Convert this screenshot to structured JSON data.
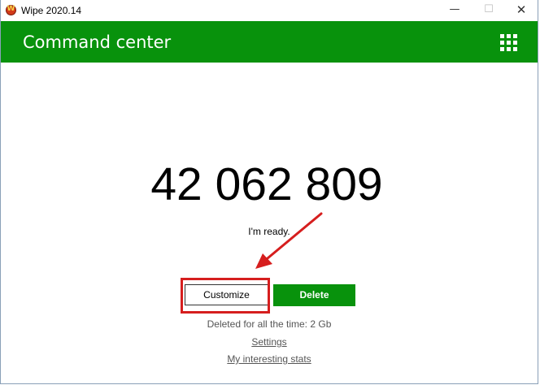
{
  "window": {
    "title": "Wipe 2020.14",
    "minimize_glyph": "—",
    "maximize_glyph": "☐",
    "close_glyph": "✕"
  },
  "header": {
    "title": "Command center",
    "menu_icon": "grid-icon"
  },
  "main": {
    "counter": "42 062 809",
    "status": "I'm ready.",
    "customize_label": "Customize",
    "delete_label": "Delete",
    "deleted_total": "Deleted for all the time: 2 Gb",
    "settings_link": "Settings",
    "stats_link": "My interesting stats"
  },
  "colors": {
    "brand_green": "#08920c",
    "annotation_red": "#d61e1e"
  }
}
